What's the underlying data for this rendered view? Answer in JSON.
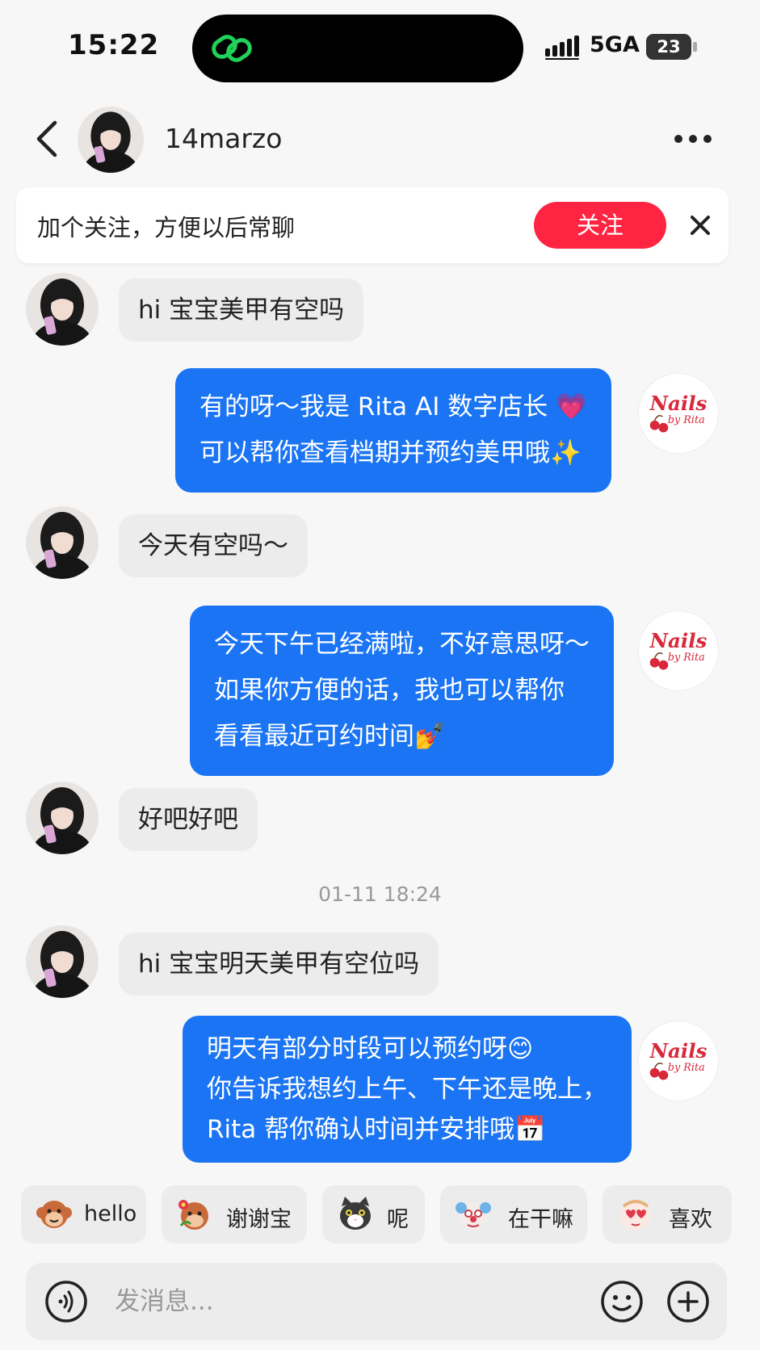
{
  "status_bar": {
    "time": "15:22",
    "network": "5GA",
    "battery": "23"
  },
  "header": {
    "username": "14marzo"
  },
  "follow_banner": {
    "text": "加个关注，方便以后常聊",
    "button_label": "关注"
  },
  "messages": [
    {
      "from": "user",
      "text": "hi  宝宝美甲有空吗"
    },
    {
      "from": "store",
      "lines": [
        "有的呀～我是 Rita AI 数字店长 💗",
        "可以帮你查看档期并预约美甲哦✨"
      ]
    },
    {
      "from": "user",
      "text": "今天有空吗～"
    },
    {
      "from": "store",
      "lines": [
        "今天下午已经满啦，不好意思呀～",
        "如果你方便的话，我也可以帮你",
        "看看最近可约时间💅"
      ]
    },
    {
      "from": "user",
      "text": "好吧好吧"
    },
    {
      "from": "user",
      "text": "hi  宝宝明天美甲有空位吗"
    },
    {
      "from": "store",
      "lines": [
        "明天有部分时段可以预约呀😊",
        "你告诉我想约上午、下午还是晚上，",
        "Rita 帮你确认时间并安排哦📅"
      ]
    }
  ],
  "timestamp": "01-11 18:24",
  "quick_replies": [
    {
      "label": "hello",
      "icon": "monkey-sticker-icon"
    },
    {
      "label": "谢谢宝",
      "icon": "monkey-flower-sticker-icon"
    },
    {
      "label": "呢",
      "icon": "cat-sticker-icon"
    },
    {
      "label": "在干嘛",
      "icon": "clown-sticker-icon"
    },
    {
      "label": "喜欢",
      "icon": "heart-sticker-icon"
    }
  ],
  "input": {
    "placeholder": "发消息..."
  },
  "colors": {
    "accent_red": "#ff2442",
    "bubble_blue": "#1a74f3",
    "bubble_gray": "#ececec",
    "background": "#f7f7f7"
  }
}
